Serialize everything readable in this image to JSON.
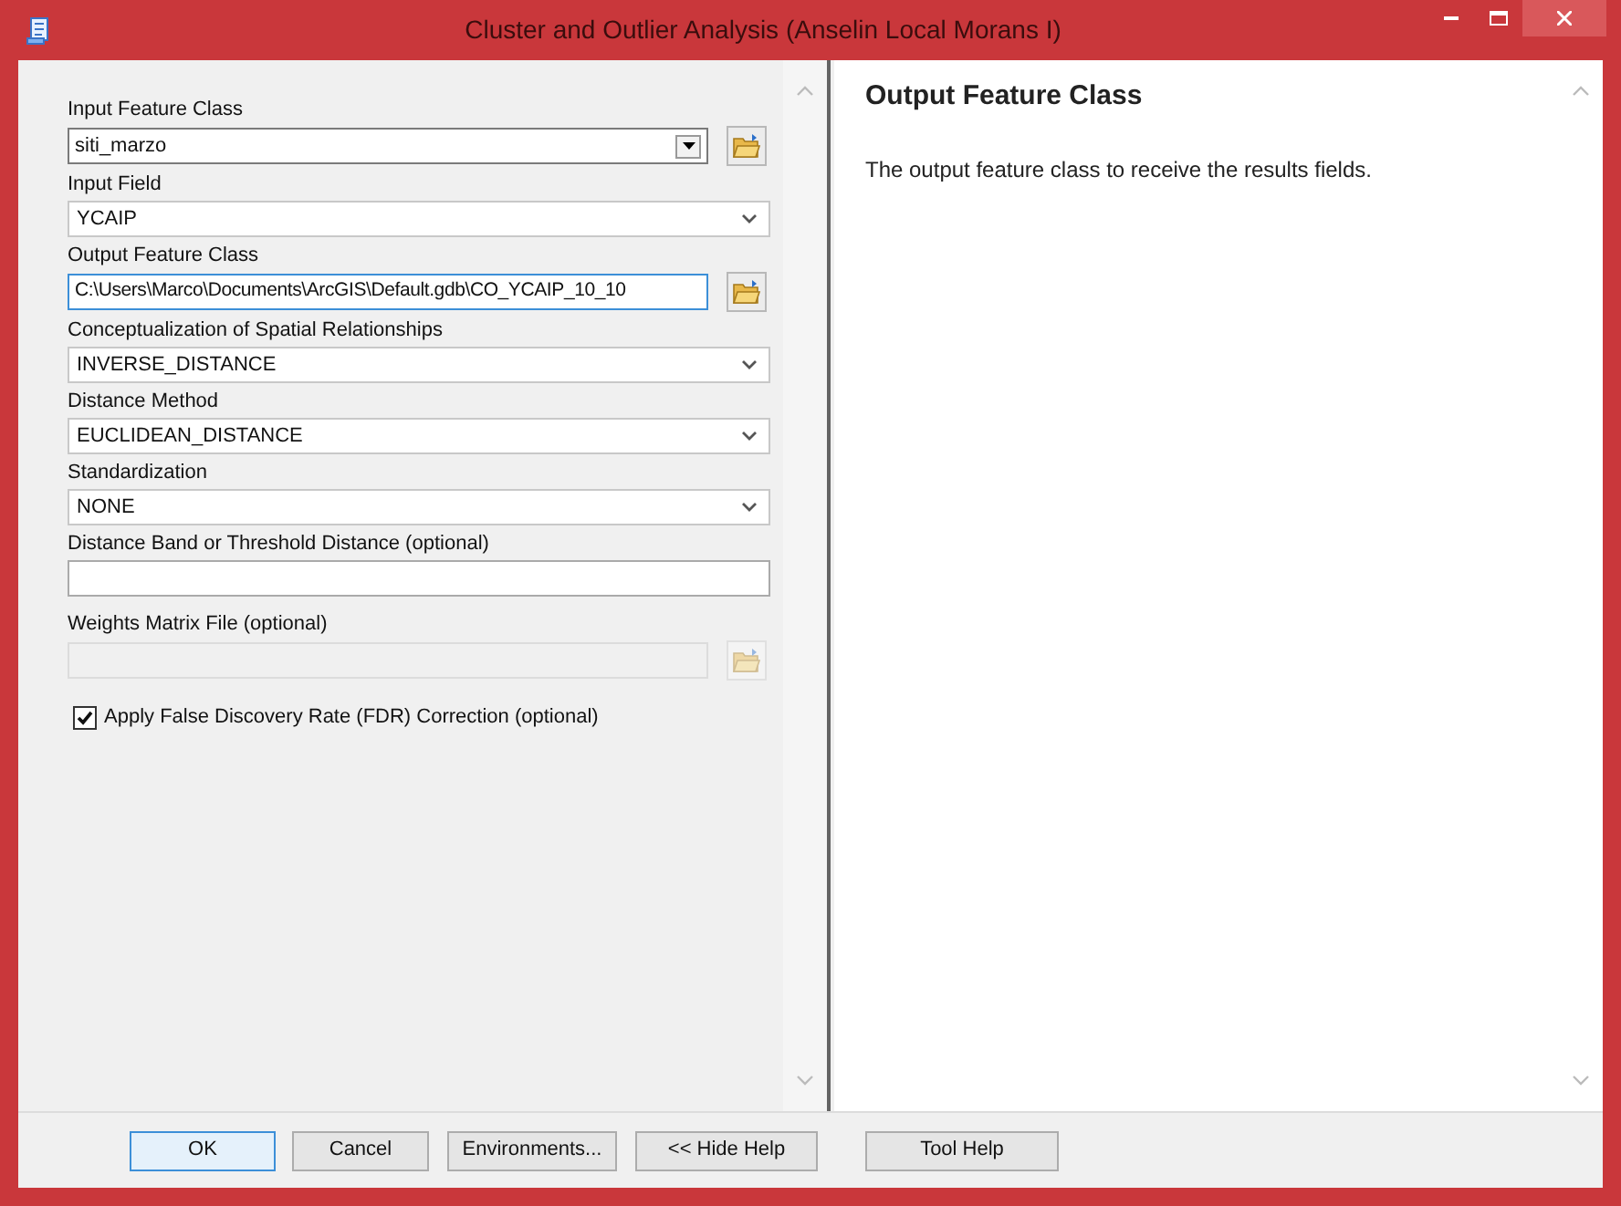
{
  "window": {
    "title": "Cluster and Outlier Analysis (Anselin Local Morans I)"
  },
  "parameters": [
    {
      "kind": "combo",
      "label": "Input Feature Class",
      "value": "siti_marzo",
      "browse": true,
      "disabled": false
    },
    {
      "kind": "select",
      "label": "Input Field",
      "value": "YCAIP",
      "browse": false,
      "disabled": false
    },
    {
      "kind": "text",
      "label": "Output Feature Class",
      "value": "C:\\Users\\Marco\\Documents\\ArcGIS\\Default.gdb\\CO_YCAIP_10_10",
      "browse": true,
      "disabled": false
    },
    {
      "kind": "select",
      "label": "Conceptualization of Spatial Relationships",
      "value": "INVERSE_DISTANCE",
      "browse": false,
      "disabled": false
    },
    {
      "kind": "select",
      "label": "Distance Method",
      "value": "EUCLIDEAN_DISTANCE",
      "browse": false,
      "disabled": false
    },
    {
      "kind": "select",
      "label": "Standardization",
      "value": "NONE",
      "browse": false,
      "disabled": false
    },
    {
      "kind": "text",
      "label": "Distance Band or Threshold Distance (optional)",
      "browse": false,
      "disabled": false
    },
    {
      "kind": "text",
      "label": "Weights Matrix File (optional)",
      "browse": true,
      "disabled": true
    },
    {
      "kind": "checkbox",
      "label": "Apply False Discovery Rate (FDR) Correction (optional)",
      "checked": true
    }
  ],
  "help": {
    "title": "Output Feature Class",
    "text": "The output feature class to receive the results fields."
  },
  "buttons": [
    {
      "label": "OK",
      "selected": true
    },
    {
      "label": "Cancel",
      "selected": false
    },
    {
      "label": "Environments...",
      "selected": false
    },
    {
      "label": "<< Hide Help",
      "selected": false
    },
    {
      "label": "Tool Help",
      "selected": false
    }
  ]
}
